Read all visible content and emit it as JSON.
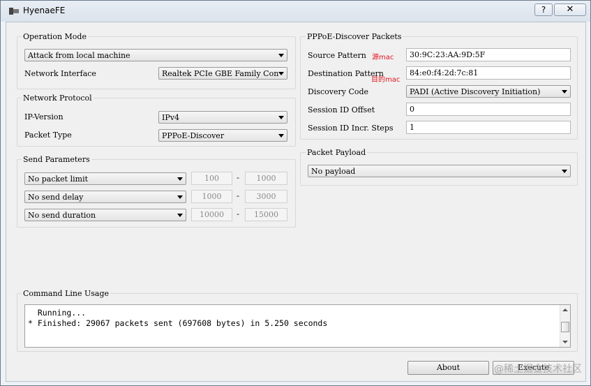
{
  "window": {
    "title": "HyenaeFE",
    "help_glyph": "?",
    "close_glyph": "✕"
  },
  "operation_mode": {
    "title": "Operation Mode",
    "mode": "Attack from local machine",
    "interface_label": "Network Interface",
    "interface_value": "Realtek PCIe GBE Family Con"
  },
  "network_protocol": {
    "title": "Network Protocol",
    "ip_label": "IP-Version",
    "ip_value": "IPv4",
    "packet_type_label": "Packet Type",
    "packet_type_value": "PPPoE-Discover"
  },
  "send_parameters": {
    "title": "Send Parameters",
    "rows": [
      {
        "mode": "No packet limit",
        "min": "100",
        "max": "1000"
      },
      {
        "mode": "No send delay",
        "min": "1000",
        "max": "3000"
      },
      {
        "mode": "No send duration",
        "min": "10000",
        "max": "15000"
      }
    ],
    "separator": "-"
  },
  "pppoe_discover": {
    "title": "PPPoE-Discover Packets",
    "source_label": "Source Pattern",
    "source_value": "30:9C:23:AA:9D:5F",
    "source_annotation": "源mac",
    "dest_label": "Destination Pattern",
    "dest_value": "84:e0:f4:2d:7c:81",
    "dest_annotation": "目的mac",
    "code_label": "Discovery Code",
    "code_value": "PADI (Active Discovery Initiation)",
    "session_label": "Session ID Offset",
    "session_value": "0",
    "steps_label": "Session ID Incr. Steps",
    "steps_value": "1"
  },
  "packet_payload": {
    "title": "Packet Payload",
    "value": "No payload"
  },
  "command_line": {
    "title": "Command Line Usage",
    "lines": [
      "  Running...",
      "* Finished: 29067 packets sent (697608 bytes) in 5.250 seconds"
    ]
  },
  "buttons": {
    "about": "About",
    "execute": "Execute"
  },
  "watermark": "@稀土掘金技术社区"
}
